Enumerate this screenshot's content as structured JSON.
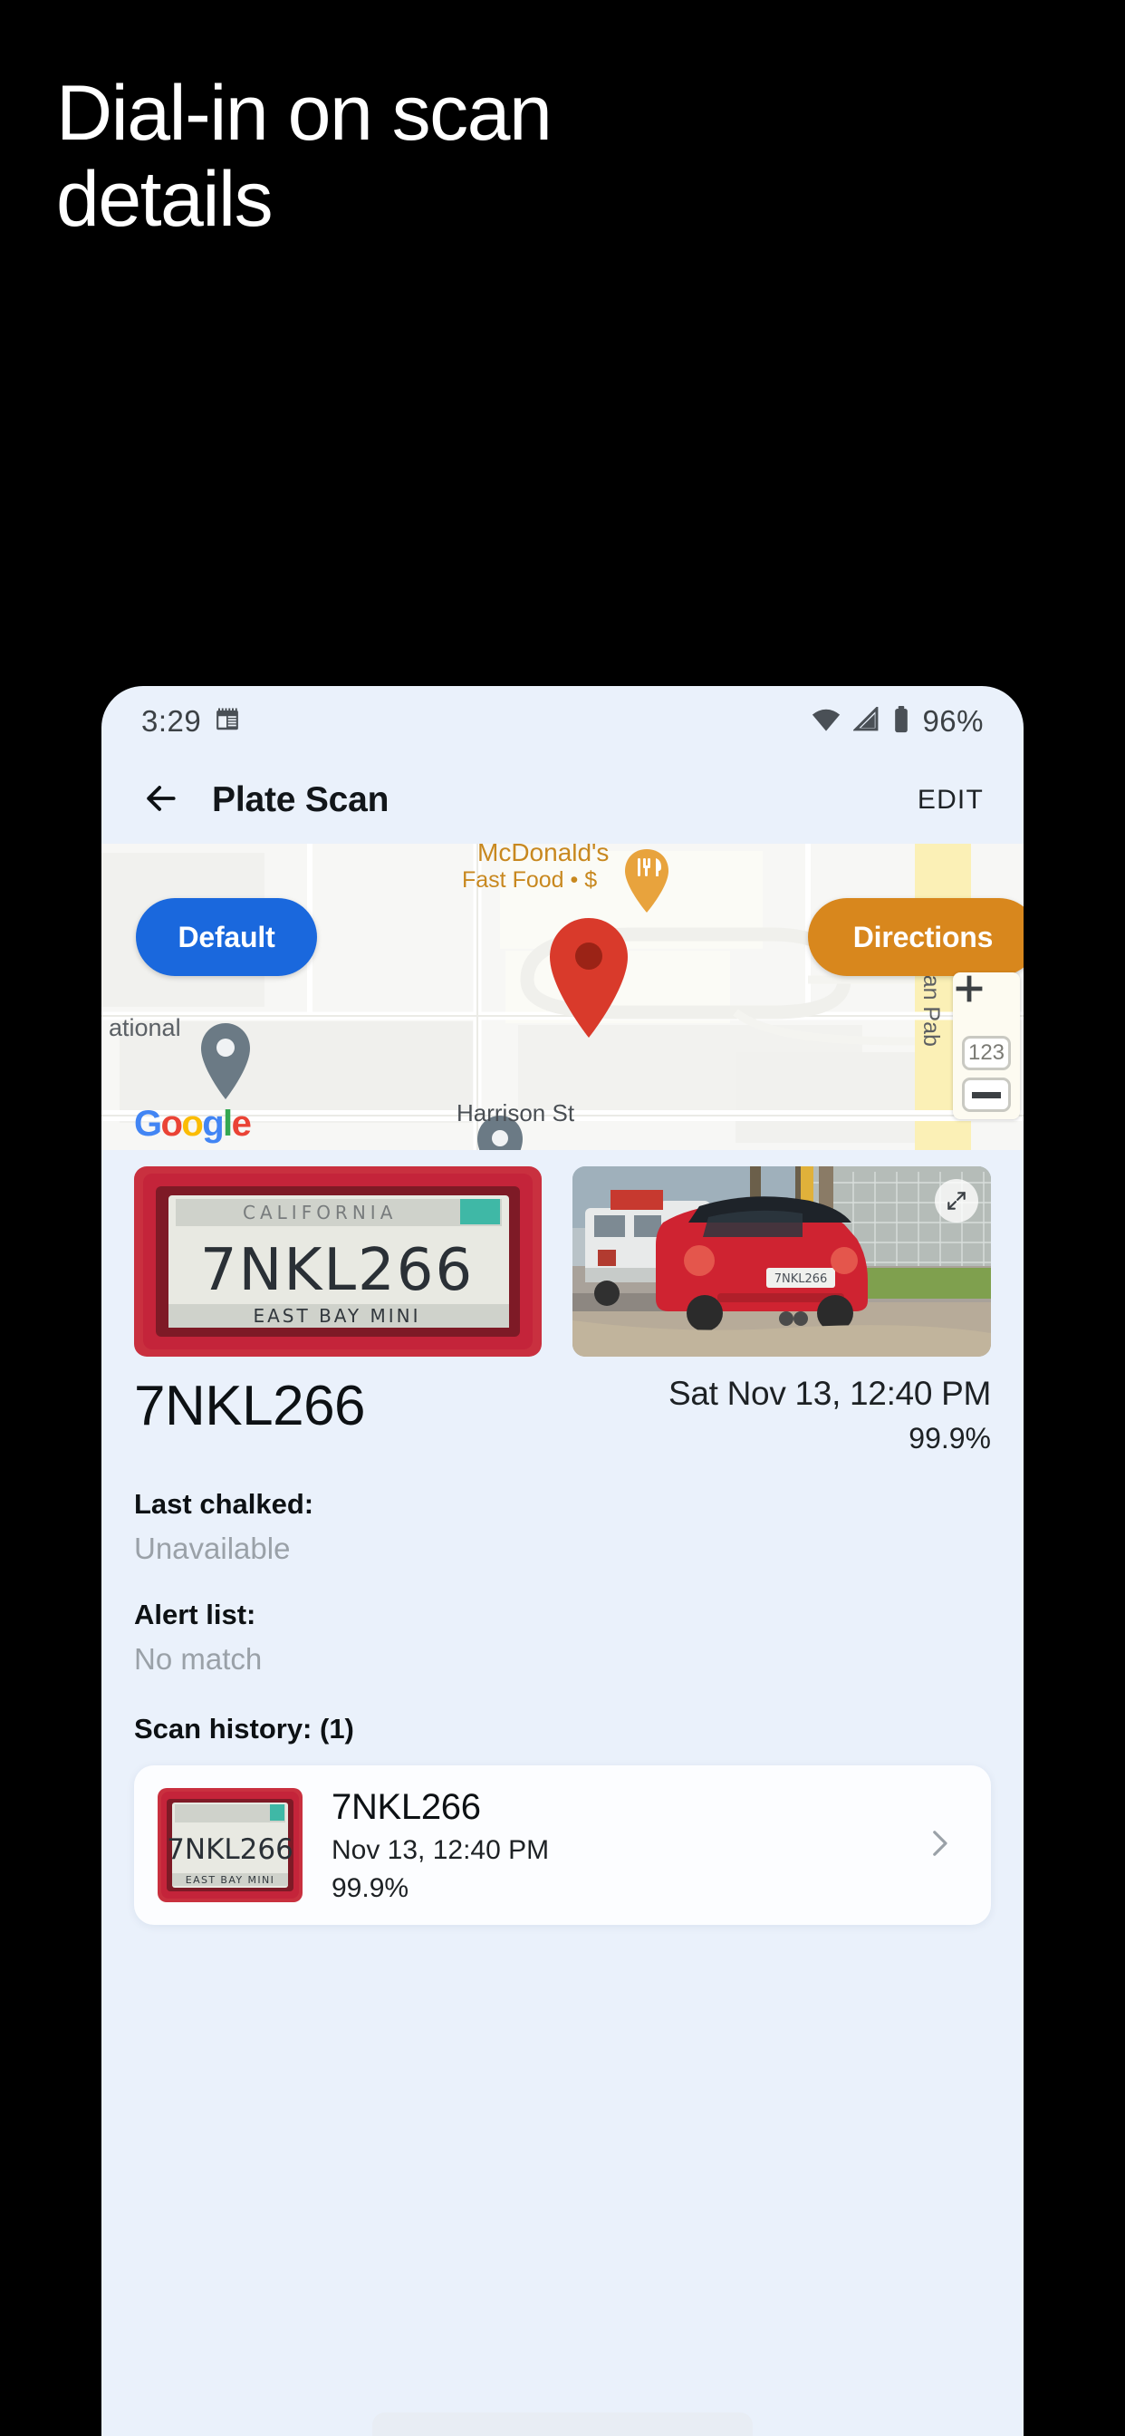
{
  "promo": {
    "headline_line1": "Dial-in on scan",
    "headline_line2": "details"
  },
  "status_bar": {
    "time": "3:29",
    "notification_icon": "calendar-icon",
    "wifi_icon": "wifi-icon",
    "signal_icon": "cellular-signal-icon",
    "battery_icon": "battery-icon",
    "battery_level": "96%"
  },
  "app_bar": {
    "back_icon": "back-arrow-icon",
    "title": "Plate Scan",
    "edit_label": "EDIT"
  },
  "map": {
    "default_chip": "Default",
    "directions_chip": "Directions",
    "poi_name": "McDonald's",
    "poi_subtitle": "Fast Food • $",
    "street_label": "Harrison St",
    "highway_label": "San Pab",
    "partial_label": "ational",
    "zoom_in_icon": "plus-icon",
    "zoom_out_icon": "minus-icon",
    "route_shield_label": "123",
    "attribution": "Google",
    "attribution_letters": [
      "G",
      "o",
      "o",
      "g",
      "l",
      "e"
    ],
    "marker_primary_icon": "map-pin-red-icon",
    "marker_secondary_icon": "map-pin-gray-icon",
    "colors": {
      "chip_default_bg": "#1a68dd",
      "chip_directions_bg": "#d8871d",
      "highway_fill": "#fbf0b6",
      "pin_red": "#d93a2b",
      "pin_gray": "#6b7a85"
    }
  },
  "media": {
    "plate_thumbnail_alt": "license-plate-photo",
    "vehicle_thumbnail_alt": "vehicle-photo",
    "expand_icon": "expand-photo-icon",
    "plate_text_on_image": "7NKL266",
    "plate_frame_text": "EAST BAY MINI"
  },
  "scan": {
    "plate": "7NKL266",
    "timestamp": "Sat Nov 13, 12:40 PM",
    "confidence": "99.9%"
  },
  "fields": [
    {
      "label": "Last chalked:",
      "value": "Unavailable"
    },
    {
      "label": "Alert list:",
      "value": "No match"
    }
  ],
  "history": {
    "label": "Scan history: (1)",
    "chevron_icon": "chevron-right-icon",
    "items": [
      {
        "plate": "7NKL266",
        "when": "Nov 13, 12:40 PM",
        "confidence": "99.9%",
        "thumbnail_alt": "license-plate-thumbnail"
      }
    ]
  }
}
